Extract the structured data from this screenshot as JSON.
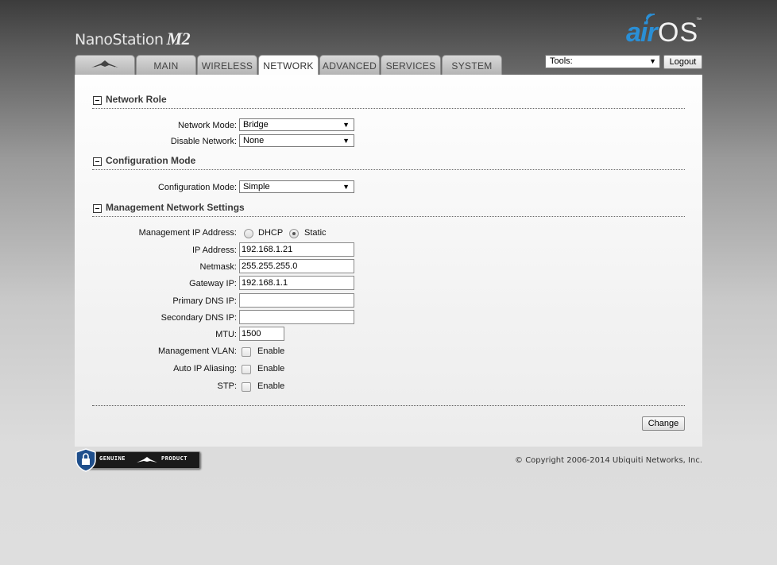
{
  "header": {
    "device_name": "NanoStation",
    "device_model": "M2",
    "logo_air": "air",
    "logo_os": "OS",
    "logo_tm": "™"
  },
  "tabs": [
    {
      "label": "",
      "icon": "ubiquiti-logo-icon"
    },
    {
      "label": "MAIN"
    },
    {
      "label": "WIRELESS"
    },
    {
      "label": "NETWORK",
      "active": true
    },
    {
      "label": "ADVANCED"
    },
    {
      "label": "SERVICES"
    },
    {
      "label": "SYSTEM"
    }
  ],
  "tools": {
    "selected": "Tools:"
  },
  "logout_label": "Logout",
  "network_role": {
    "title": "Network Role",
    "network_mode_label": "Network Mode:",
    "network_mode_value": "Bridge",
    "disable_network_label": "Disable Network:",
    "disable_network_value": "None"
  },
  "configuration_mode": {
    "title": "Configuration Mode",
    "label": "Configuration Mode:",
    "value": "Simple"
  },
  "management": {
    "title": "Management Network Settings",
    "ip_mode_label": "Management IP Address:",
    "dhcp_label": "DHCP",
    "static_label": "Static",
    "selected_mode": "Static",
    "ip_label": "IP Address:",
    "ip_value": "192.168.1.21",
    "netmask_label": "Netmask:",
    "netmask_value": "255.255.255.0",
    "gateway_label": "Gateway IP:",
    "gateway_value": "192.168.1.1",
    "primary_dns_label": "Primary DNS IP:",
    "primary_dns_value": "",
    "secondary_dns_label": "Secondary DNS IP:",
    "secondary_dns_value": "",
    "mtu_label": "MTU:",
    "mtu_value": "1500",
    "vlan_label": "Management VLAN:",
    "auto_alias_label": "Auto IP Aliasing:",
    "stp_label": "STP:",
    "enable_label": "Enable"
  },
  "change_label": "Change",
  "badge": {
    "left": "GENUINE",
    "right": "PRODUCT"
  },
  "footer": {
    "copyright": "© Copyright 2006-2014 Ubiquiti Networks, Inc."
  }
}
